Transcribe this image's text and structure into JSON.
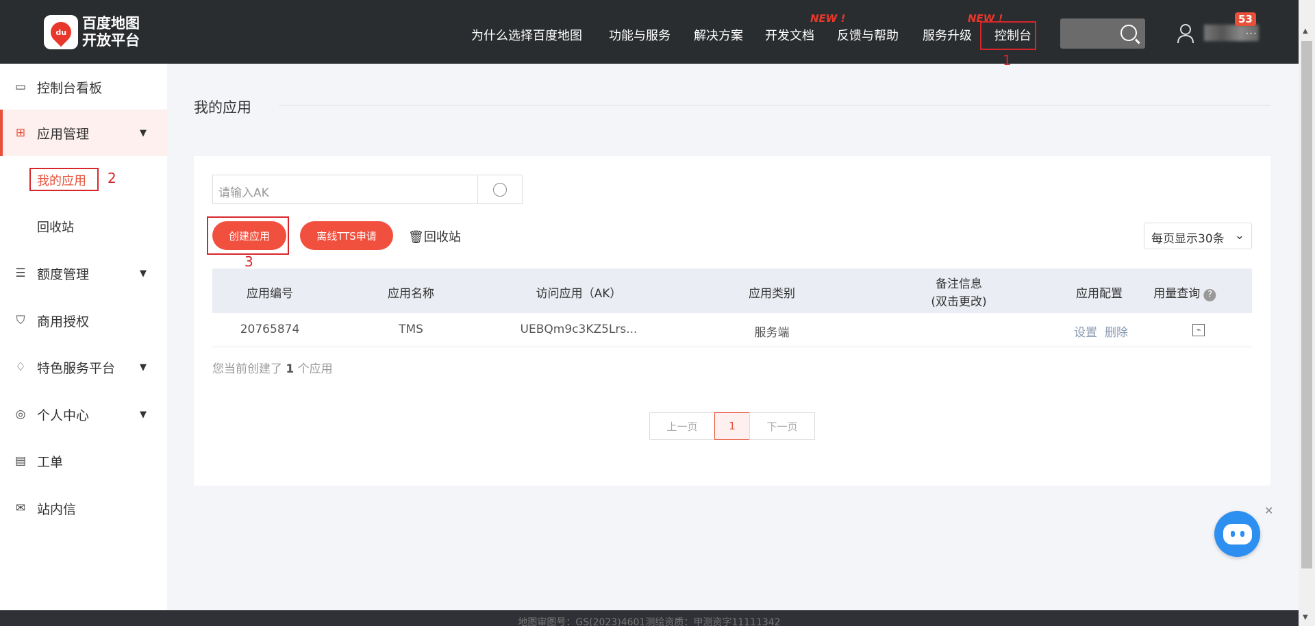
{
  "header": {
    "logo_line1": "百度地图",
    "logo_line2": "开放平台",
    "logo_badge": "du",
    "nav": [
      "为什么选择百度地图",
      "功能与服务",
      "解决方案",
      "开发文档",
      "反馈与帮助",
      "服务升级",
      "控制台"
    ],
    "new_label": "NEW !",
    "badge_count": "53",
    "username_suffix": "..."
  },
  "sidebar": {
    "items": [
      {
        "label": "控制台看板",
        "icon": "dashboard-card-icon"
      },
      {
        "label": "应用管理",
        "icon": "grid-icon"
      },
      {
        "label": "额度管理",
        "icon": "sliders-icon"
      },
      {
        "label": "商用授权",
        "icon": "shield-icon"
      },
      {
        "label": "特色服务平台",
        "icon": "diamond-icon"
      },
      {
        "label": "个人中心",
        "icon": "user-circle-icon"
      },
      {
        "label": "工单",
        "icon": "clipboard-icon"
      },
      {
        "label": "站内信",
        "icon": "mail-icon"
      }
    ],
    "sub": [
      "我的应用",
      "回收站"
    ]
  },
  "main": {
    "title": "我的应用",
    "search_placeholder": "请输入AK",
    "create_button": "创建应用",
    "tts_button": "离线TTS申请",
    "recycle": "回收站",
    "per_page": "每页显示30条",
    "columns": [
      "应用编号",
      "应用名称",
      "访问应用（AK）",
      "应用类别",
      "备注信息",
      "(双击更改)",
      "应用配置",
      "用量查询"
    ],
    "rows": [
      {
        "id": "20765874",
        "name": "TMS",
        "ak": "UEBQm9c3KZ5Lrs...",
        "type": "服务端",
        "note": "",
        "settings": "设置",
        "delete": "删除"
      }
    ],
    "count_prefix": "您当前创建了",
    "count": "1",
    "count_suffix": "个应用",
    "pagination": {
      "prev": "上一页",
      "current": "1",
      "next": "下一页"
    }
  },
  "annotations": [
    "1",
    "2",
    "3"
  ],
  "footer": "地图审图号：GS(2023)4601测绘资质：甲测资字11111342",
  "colors": {
    "accent": "#f2503f",
    "header": "#2a2d2f",
    "annotation": "#d6262b"
  }
}
